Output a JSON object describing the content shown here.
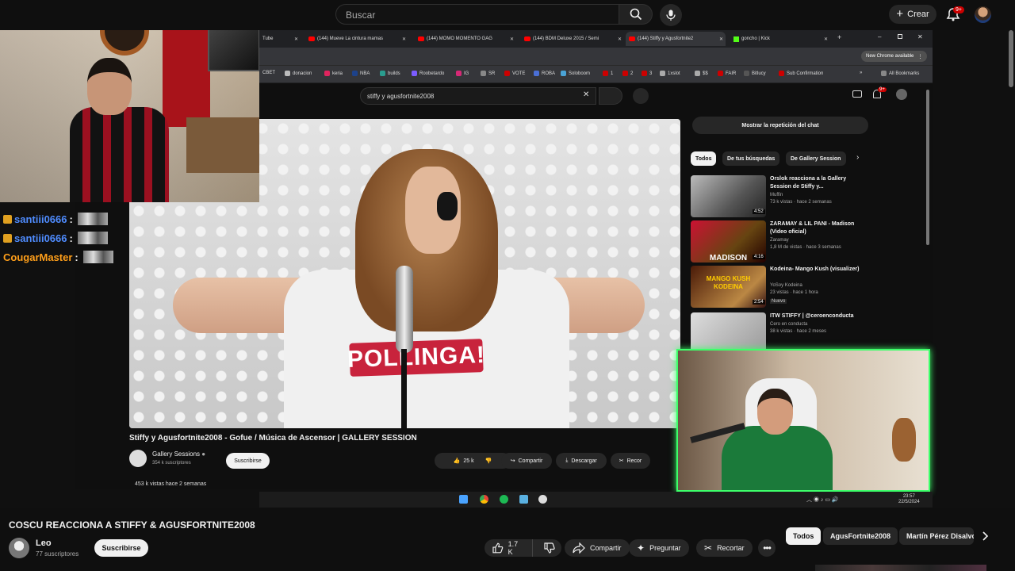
{
  "header": {
    "search_placeholder": "Buscar",
    "create_label": "Crear",
    "notifications_badge": "9+"
  },
  "stream": {
    "chat": [
      {
        "user": "santiii0666",
        "color": "#4f8cff"
      },
      {
        "user": "santiii0666",
        "color": "#4f8cff"
      },
      {
        "user": "CougarMaster",
        "color": "#ff9f1a"
      }
    ],
    "browser": {
      "tabs": [
        {
          "label": "Tube"
        },
        {
          "label": "(144) Mueve La cintura mamas"
        },
        {
          "label": "(144) MOMO MOMENTO GAG"
        },
        {
          "label": "(144) BDM Deluxe 2015 / Semi"
        },
        {
          "label": "(144) Stiffy y Agusfortnite2"
        },
        {
          "label": "goncho | Kick"
        }
      ],
      "new_chrome": "New Chrome available",
      "bookmarks": [
        "CBET",
        "donacion",
        "keria",
        "NBA",
        "builds",
        "Roobetardo",
        "IG",
        "SR",
        "VOTE",
        "ROBA",
        "Soloboom",
        "1",
        "2",
        "3",
        "1xslot",
        "$$",
        "FAIR",
        "Bitlucy",
        "Sub Confirmation"
      ],
      "all_bookmarks": "All Bookmarks"
    },
    "inner": {
      "search_value": "stiffy y agusfortnite2008",
      "notif_badge": "9+",
      "video_logo_text": "POLLINGA!",
      "video_title": "Stiffy y Agusfortnite2008 - Gofue / Música de Ascensor | GALLERY SESSION",
      "channel": "Gallery Sessions",
      "subs": "354 k suscriptores",
      "subscribe": "Suscribirse",
      "likes": "25 k",
      "share": "Compartir",
      "download": "Descargar",
      "clip": "Recor",
      "views": "453 k vistas  hace 2 semanas",
      "chat_replay": "Mostrar la repetición del chat",
      "chips": [
        "Todos",
        "De tus búsquedas",
        "De Gallery Session"
      ],
      "recommendations": [
        {
          "title": "Orslok reacciona a la Gallery Session de Stiffy y...",
          "channel": "Muffin",
          "views": "73 k vistas · hace 2 semanas",
          "duration": "4:52",
          "badge": ""
        },
        {
          "title": "ZARAMAY & LIL PANI - Madison (Video oficial)",
          "channel": "Zaramay",
          "views": "1,8 M de vistas · hace 3 semanas",
          "duration": "4:16",
          "badge": ""
        },
        {
          "title": "Kodeina- Mango Kush (visualizer)",
          "channel": "YoSoy Kodeina",
          "views": "23 vistas · hace 1 hora",
          "duration": "2:54",
          "badge": "Nuevo"
        },
        {
          "title": "ITW STIFFY | @ceroenconducta",
          "channel": "Cero en conducta",
          "views": "38 k vistas · hace 2 meses",
          "duration": "",
          "badge": ""
        }
      ],
      "thumb_texts": [
        "MADISON",
        "MANGO KUSH",
        "KODEINA"
      ]
    },
    "clock": {
      "time": "23:57",
      "date": "22/5/2024"
    }
  },
  "video": {
    "title": "COSCU REACCIONA A STIFFY & AGUSFORTNITE2008",
    "channel": "Leo",
    "subs": "77 suscriptores",
    "subscribe": "Suscribirse",
    "likes": "1.7 K",
    "share": "Compartir",
    "ask": "Preguntar",
    "clip": "Recortar"
  },
  "chips": [
    "Todos",
    "AgusFortnite2008",
    "Martín Pérez Disalvo"
  ],
  "colors": {
    "accent": "#3dff6a",
    "brand_red": "#ff0000",
    "background": "#0f0f0f"
  }
}
